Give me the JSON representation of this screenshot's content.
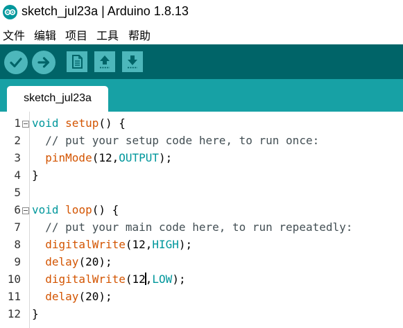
{
  "window": {
    "title": "sketch_jul23a | Arduino 1.8.13",
    "icon": "arduino-logo-icon"
  },
  "menu": [
    "文件",
    "编辑",
    "项目",
    "工具",
    "帮助"
  ],
  "toolbar": {
    "buttons": [
      "verify-icon",
      "upload-icon",
      "new-icon",
      "open-icon",
      "save-icon"
    ]
  },
  "tabs": [
    {
      "label": "sketch_jul23a"
    }
  ],
  "editor": {
    "lines": [
      {
        "n": "1",
        "fold": true,
        "tokens": [
          {
            "t": "void",
            "c": "kw"
          },
          {
            "t": " "
          },
          {
            "t": "setup",
            "c": "fn"
          },
          {
            "t": "() {"
          }
        ]
      },
      {
        "n": "2",
        "fold": false,
        "tokens": [
          {
            "t": "  // put your setup code here, to run once:",
            "c": "cm"
          }
        ]
      },
      {
        "n": "3",
        "fold": false,
        "tokens": [
          {
            "t": "  "
          },
          {
            "t": "pinMode",
            "c": "fn"
          },
          {
            "t": "(12,"
          },
          {
            "t": "OUTPUT",
            "c": "const"
          },
          {
            "t": ");"
          }
        ]
      },
      {
        "n": "4",
        "fold": false,
        "tokens": [
          {
            "t": "}"
          }
        ]
      },
      {
        "n": "5",
        "fold": false,
        "tokens": []
      },
      {
        "n": "6",
        "fold": true,
        "tokens": [
          {
            "t": "void",
            "c": "kw"
          },
          {
            "t": " "
          },
          {
            "t": "loop",
            "c": "fn"
          },
          {
            "t": "() {"
          }
        ]
      },
      {
        "n": "7",
        "fold": false,
        "tokens": [
          {
            "t": "  // put your main code here, to run repeatedly:",
            "c": "cm"
          }
        ]
      },
      {
        "n": "8",
        "fold": false,
        "tokens": [
          {
            "t": "  "
          },
          {
            "t": "digitalWrite",
            "c": "fn"
          },
          {
            "t": "(12,"
          },
          {
            "t": "HIGH",
            "c": "const"
          },
          {
            "t": ");"
          }
        ]
      },
      {
        "n": "9",
        "fold": false,
        "tokens": [
          {
            "t": "  "
          },
          {
            "t": "delay",
            "c": "fn"
          },
          {
            "t": "(20);"
          }
        ]
      },
      {
        "n": "10",
        "fold": false,
        "tokens": [
          {
            "t": "  "
          },
          {
            "t": "digitalWrite",
            "c": "fn"
          },
          {
            "t": "(12"
          },
          {
            "t": "",
            "caret": true
          },
          {
            "t": ","
          },
          {
            "t": "LOW",
            "c": "const"
          },
          {
            "t": ");"
          }
        ]
      },
      {
        "n": "11",
        "fold": false,
        "tokens": [
          {
            "t": "  "
          },
          {
            "t": "delay",
            "c": "fn"
          },
          {
            "t": "(20);"
          }
        ]
      },
      {
        "n": "12",
        "fold": false,
        "tokens": [
          {
            "t": "}"
          }
        ]
      }
    ]
  },
  "colors": {
    "toolbar_bg": "#006468",
    "tabstrip_bg": "#17a1a5",
    "button_bg": "#4db7bb",
    "keyword": "#00979c",
    "function": "#d35400"
  }
}
